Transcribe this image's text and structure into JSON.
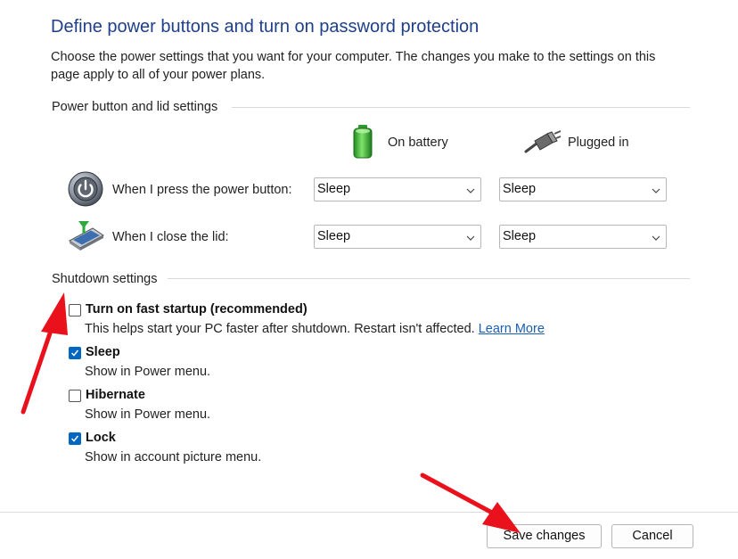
{
  "page": {
    "title": "Define power buttons and turn on password protection",
    "description": "Choose the power settings that you want for your computer. The changes you make to the settings on this page apply to all of your power plans."
  },
  "power_section": {
    "heading": "Power button and lid settings",
    "columns": {
      "battery": "On battery",
      "plugged": "Plugged in"
    },
    "rows": [
      {
        "label": "When I press the power button:",
        "icon": "power-button-icon",
        "battery": "Sleep",
        "plugged": "Sleep"
      },
      {
        "label": "When I close the lid:",
        "icon": "laptop-lid-icon",
        "battery": "Sleep",
        "plugged": "Sleep"
      }
    ]
  },
  "shutdown_section": {
    "heading": "Shutdown settings",
    "options": [
      {
        "label": "Turn on fast startup (recommended)",
        "desc": "This helps start your PC faster after shutdown. Restart isn't affected.",
        "link": "Learn More",
        "checked": false
      },
      {
        "label": "Sleep",
        "desc": "Show in Power menu.",
        "checked": true
      },
      {
        "label": "Hibernate",
        "desc": "Show in Power menu.",
        "checked": false
      },
      {
        "label": "Lock",
        "desc": "Show in account picture menu.",
        "checked": true
      }
    ]
  },
  "footer": {
    "save": "Save changes",
    "cancel": "Cancel"
  },
  "colors": {
    "title": "#1e3f8a",
    "link": "#1a5fb4",
    "checkbox_checked": "#0067c0",
    "arrow": "#e8111c"
  }
}
